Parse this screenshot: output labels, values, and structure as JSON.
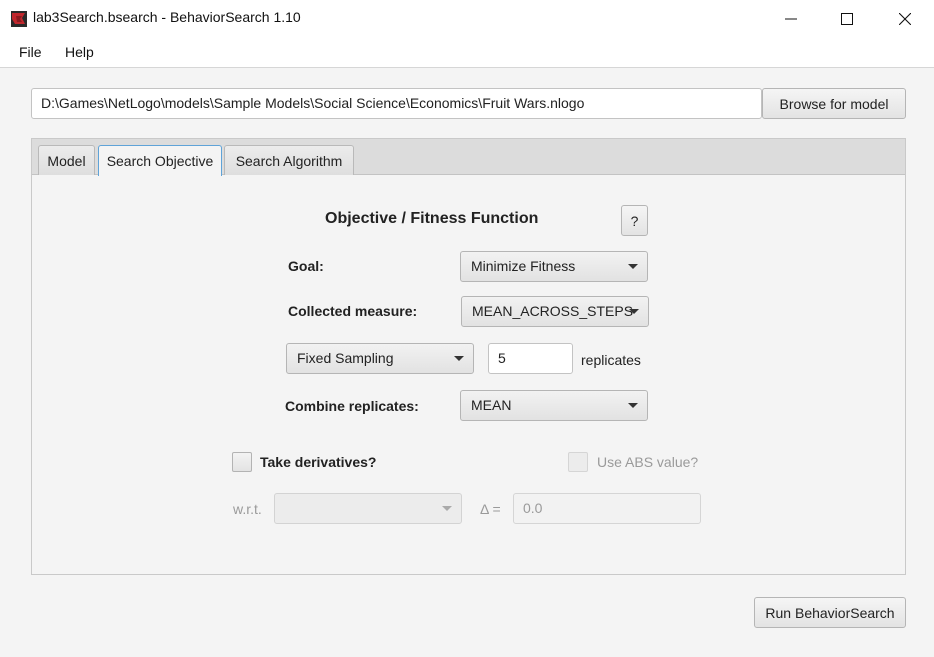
{
  "window": {
    "title": "lab3Search.bsearch - BehaviorSearch 1.10"
  },
  "menu": {
    "items": [
      {
        "label": "File"
      },
      {
        "label": "Help"
      }
    ]
  },
  "model": {
    "path": "D:\\Games\\NetLogo\\models\\Sample Models\\Social Science\\Economics\\Fruit Wars.nlogo",
    "browse_label": "Browse for model"
  },
  "tabs": [
    {
      "label": "Model",
      "active": false
    },
    {
      "label": "Search Objective",
      "active": true
    },
    {
      "label": "Search Algorithm",
      "active": false
    }
  ],
  "objective": {
    "heading": "Objective / Fitness Function",
    "help_label": "?",
    "goal_label": "Goal:",
    "goal_value": "Minimize Fitness",
    "measure_label": "Collected measure:",
    "measure_value": "MEAN_ACROSS_STEPS",
    "sampling_value": "Fixed Sampling",
    "replicates_value": "5",
    "replicates_label": "replicates",
    "combine_label": "Combine replicates:",
    "combine_value": "MEAN",
    "derivatives_label": "Take derivatives?",
    "abs_label": "Use ABS value?",
    "wrt_label": "w.r.t.",
    "wrt_value": "",
    "delta_label": "Δ =",
    "delta_value": "0.0"
  },
  "actions": {
    "run_label": "Run BehaviorSearch"
  },
  "colors": {
    "active_tab_border": "#5fa3d8",
    "app_icon": "#c0272d"
  },
  "icons": {
    "app": "behaviorsearch-app-icon",
    "minimize": "minimize-icon",
    "maximize": "maximize-icon",
    "close": "close-icon",
    "dropdown": "chevron-down-icon"
  }
}
